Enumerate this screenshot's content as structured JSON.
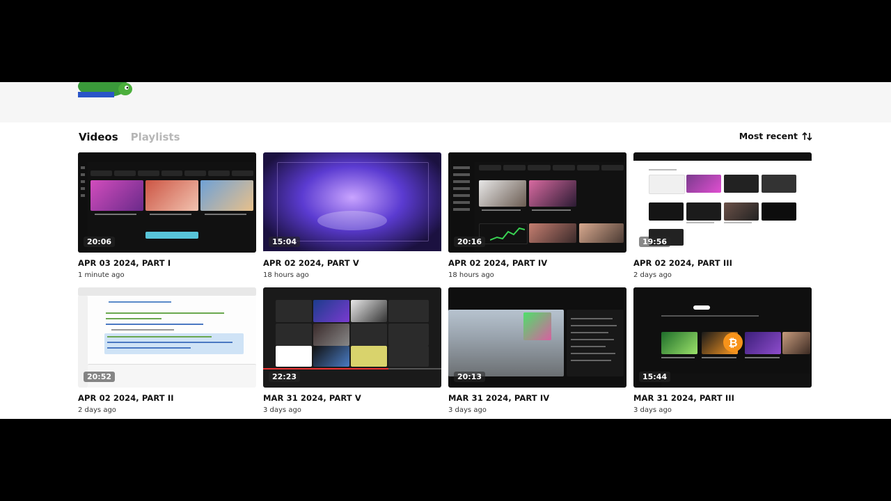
{
  "tabs": {
    "videos": "Videos",
    "playlists": "Playlists"
  },
  "sort": {
    "label": "Most recent"
  },
  "colors": {
    "accent": "#111111",
    "inactive_tab": "#b7b7b7"
  },
  "videos": [
    {
      "title": "APR 03 2024, PART I",
      "meta": "1 minute ago",
      "duration": "20:06"
    },
    {
      "title": "APR 02 2024, PART V",
      "meta": "18 hours ago",
      "duration": "15:04"
    },
    {
      "title": "APR 02 2024, PART IV",
      "meta": "18 hours ago",
      "duration": "20:16"
    },
    {
      "title": "APR 02 2024, PART III",
      "meta": "2 days ago",
      "duration": "19:56"
    },
    {
      "title": "APR 02 2024, PART II",
      "meta": "2 days ago",
      "duration": "20:52"
    },
    {
      "title": "MAR 31 2024, PART V",
      "meta": "3 days ago",
      "duration": "22:23"
    },
    {
      "title": "MAR 31 2024, PART IV",
      "meta": "3 days ago",
      "duration": "20:13"
    },
    {
      "title": "MAR 31 2024, PART III",
      "meta": "3 days ago",
      "duration": "15:44"
    }
  ]
}
